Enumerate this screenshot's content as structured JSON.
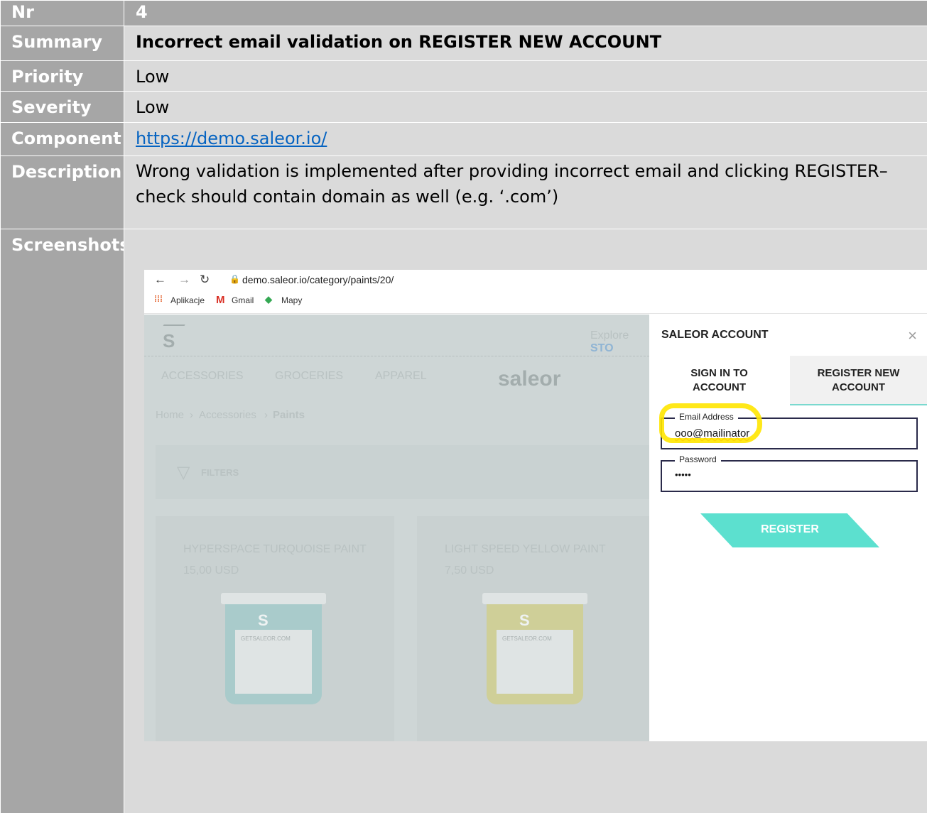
{
  "rows": {
    "nr": {
      "label": "Nr",
      "value": "4"
    },
    "summary": {
      "label": "Summary",
      "value": "Incorrect email validation on REGISTER NEW ACCOUNT"
    },
    "priority": {
      "label": "Priority",
      "value": "Low"
    },
    "severity": {
      "label": "Severity",
      "value": "Low"
    },
    "component": {
      "label": "Component",
      "value": "https://demo.saleor.io/"
    },
    "description": {
      "label": "Description",
      "line1": "Wrong validation is implemented after providing incorrect email and clicking REGISTER–",
      "line2": "check should contain domain as well (e.g. ‘.com’)"
    },
    "screenshots": {
      "label": "Screenshots"
    }
  },
  "browser": {
    "url": "demo.saleor.io/category/paints/20/",
    "bookmarks": [
      "Aplikacje",
      "Gmail",
      "Mapy"
    ]
  },
  "site": {
    "explore": "Explore",
    "explore_accent": "STO",
    "nav": [
      "ACCESSORIES",
      "GROCERIES",
      "APPAREL"
    ],
    "logo": "saleor",
    "breadcrumb": [
      "Home",
      "Accessories",
      "Paints"
    ],
    "filters": "FILTERS",
    "products": [
      {
        "name": "HYPERSPACE TURQUOISE PAINT",
        "price": "15,00 USD",
        "brand": "GETSALEOR.COM",
        "color": "#a9cbcb"
      },
      {
        "name": "LIGHT SPEED YELLOW PAINT",
        "price": "7,50 USD",
        "brand": "GETSALEOR.COM",
        "color": "#cfcf98"
      }
    ]
  },
  "panel": {
    "title": "SALEOR ACCOUNT",
    "close": "×",
    "tab_signin": "SIGN IN TO ACCOUNT",
    "tab_register": "REGISTER NEW ACCOUNT",
    "email_label": "Email Address",
    "email_value": "ooo@mailinator",
    "password_label": "Password",
    "password_value": "•••••",
    "register_button": "REGISTER"
  }
}
